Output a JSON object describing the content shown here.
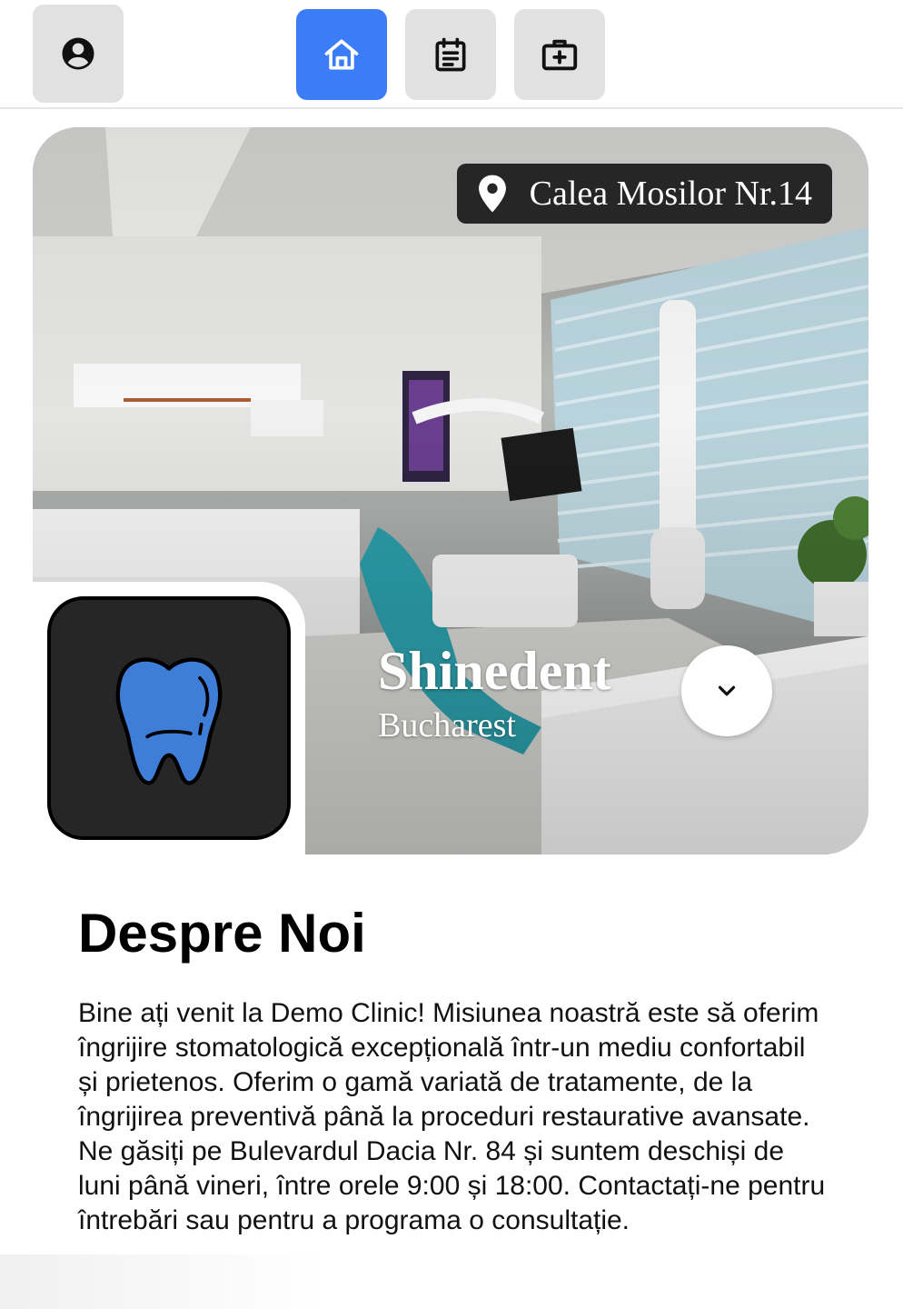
{
  "nav": {
    "items": [
      {
        "id": "profile",
        "icon": "account-circle-icon",
        "active": false
      },
      {
        "id": "home",
        "icon": "home-icon",
        "active": true
      },
      {
        "id": "appointments",
        "icon": "calendar-notes-icon",
        "active": false
      },
      {
        "id": "services",
        "icon": "medical-bag-icon",
        "active": false
      }
    ],
    "active_color": "#3a7df6",
    "inactive_color": "#e1e1e1"
  },
  "hero": {
    "address": "Calea Mosilor Nr.14",
    "address_icon": "map-pin-icon",
    "clinic_name": "Shinedent",
    "city": "Bucharest",
    "logo_icon": "tooth-icon",
    "logo_color": "#3f7ed8",
    "expand_icon": "chevron-down-icon"
  },
  "about": {
    "title": "Despre Noi",
    "text": "Bine ați venit la Demo Clinic! Misiunea noastră este să oferim îngrijire stomatologică excepțională într-un mediu confortabil și prietenos. Oferim o gamă variată de tratamente, de la îngrijirea preventivă până la proceduri restaurative avansate. Ne găsiți pe Bulevardul Dacia Nr. 84 și suntem deschiși de luni până vineri, între orele 9:00 și 18:00. Contactați-ne pentru întrebări sau pentru a programa o consultație."
  }
}
